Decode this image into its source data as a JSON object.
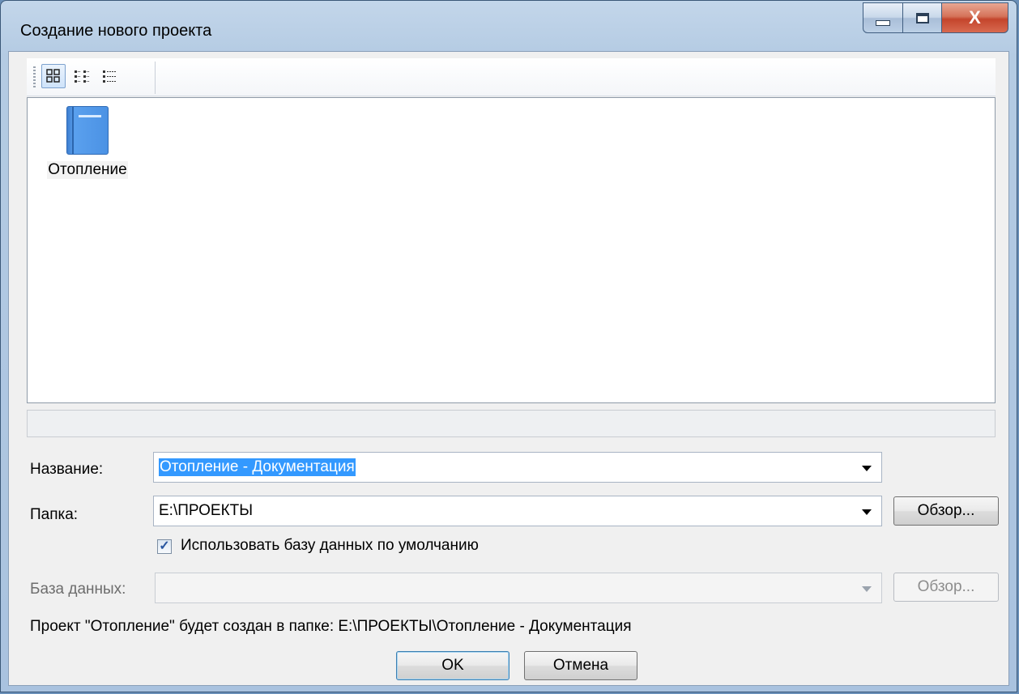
{
  "window": {
    "title": "Создание нового проекта",
    "close_glyph": "X"
  },
  "toolbar": {
    "views": [
      {
        "name": "large-icons-view-icon",
        "active": true
      },
      {
        "name": "small-icons-view-icon",
        "active": false
      },
      {
        "name": "list-view-icon",
        "active": false
      }
    ]
  },
  "templates": [
    {
      "label": "Отопление",
      "icon": "book-icon",
      "color": "#4b92e4"
    }
  ],
  "form": {
    "name_label": "Название:",
    "name_value": "Отопление - Документация",
    "folder_label": "Папка:",
    "folder_value": "E:\\ПРОЕКТЫ",
    "browse_label": "Обзор...",
    "use_default_db_label": "Использовать базу данных по умолчанию",
    "use_default_db_checked": true,
    "check_glyph": "✓",
    "db_label": "База данных:",
    "db_value": "",
    "db_browse_label": "Обзор...",
    "info_text": "Проект \"Отопление\" будет создан в папке: E:\\ПРОЕКТЫ\\Отопление - Документация"
  },
  "buttons": {
    "ok_label": "OK",
    "cancel_label": "Отмена"
  },
  "colors": {
    "selection": "#3399ff",
    "close_button": "#c4452c"
  }
}
